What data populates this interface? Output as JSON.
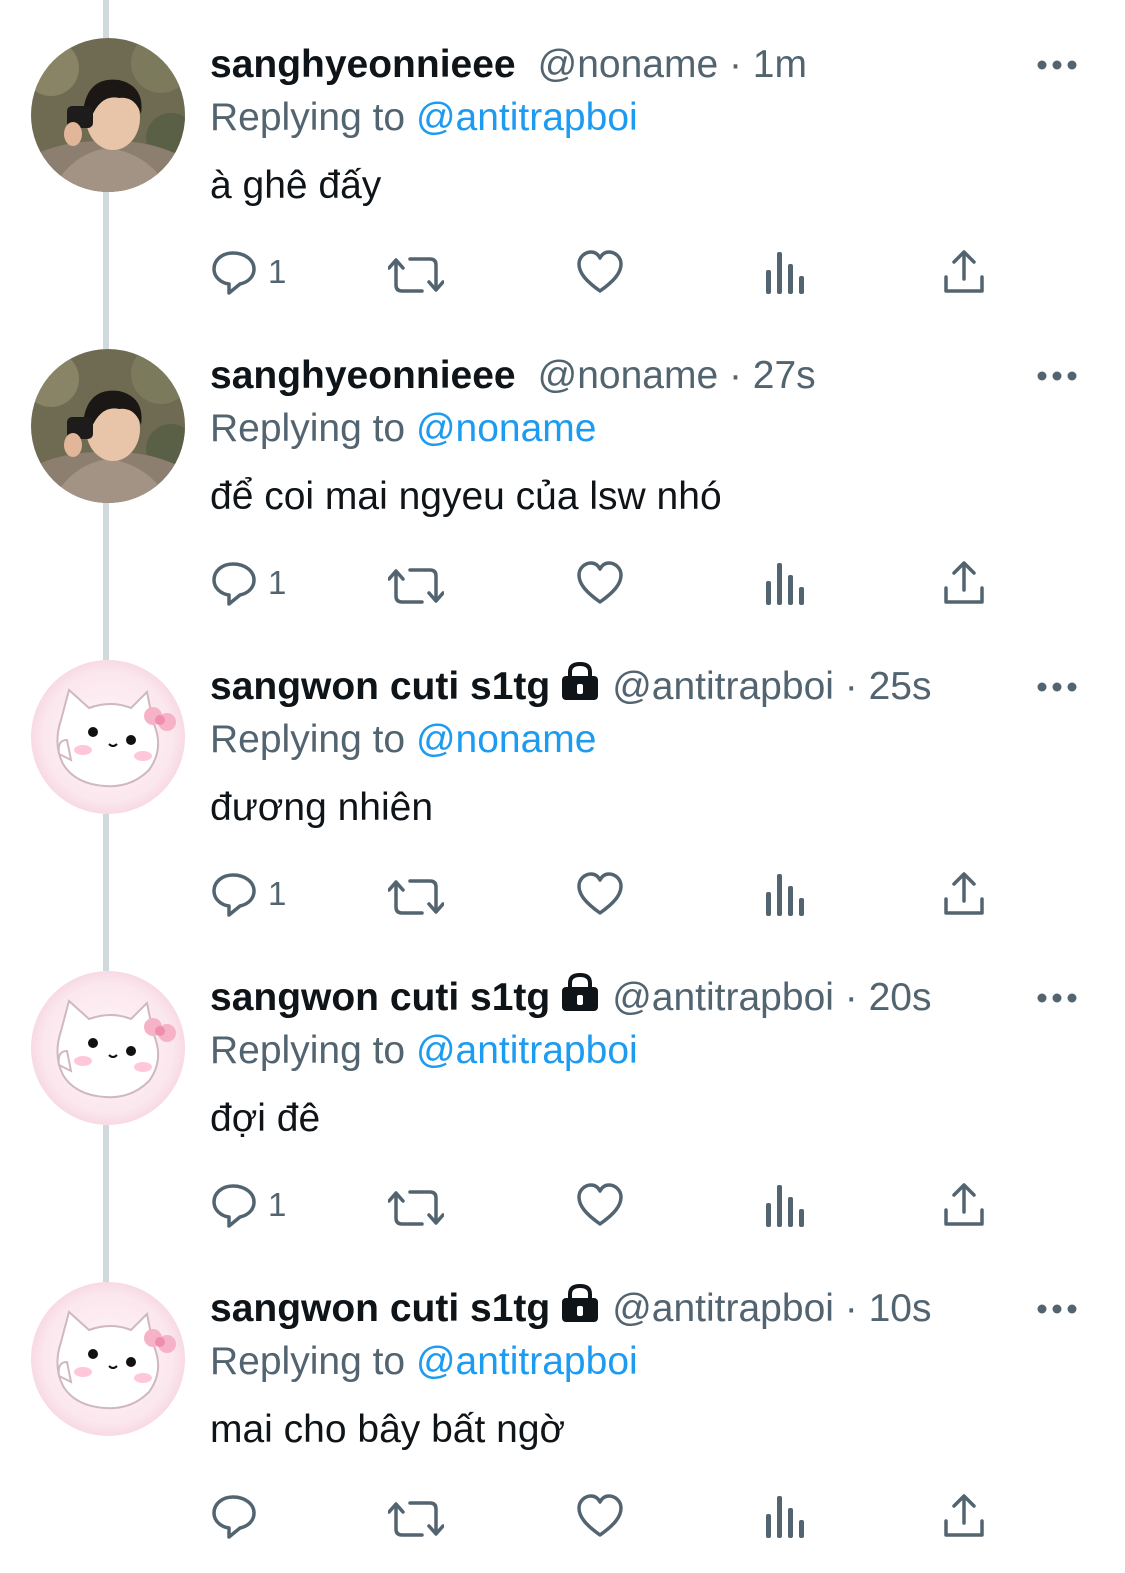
{
  "colors": {
    "accent": "#1d9bf0",
    "secondary_text": "#536471",
    "primary_text": "#0f1419",
    "thread_line": "#cfd9de"
  },
  "tweets": [
    {
      "display_name": "sanghyeonnieee",
      "protected": false,
      "handle": "@noname",
      "time": "· 1m",
      "reply_prefix": "Replying to ",
      "reply_to": "@antitrapboi",
      "text": "à ghê đấy",
      "reply_count": "1",
      "avatar": "photo-avatar"
    },
    {
      "display_name": "sanghyeonnieee",
      "protected": false,
      "handle": "@noname",
      "time": "· 27s",
      "reply_prefix": "Replying to ",
      "reply_to": "@noname",
      "text": "để coi mai ngyeu của lsw nhó",
      "reply_count": "1",
      "avatar": "photo-avatar"
    },
    {
      "display_name": "sangwon cuti s1tg",
      "protected": true,
      "handle": "@antitrapboi",
      "time": "· 25s",
      "reply_prefix": "Replying to ",
      "reply_to": "@noname",
      "text": "đương nhiên",
      "reply_count": "1",
      "avatar": "cat-avatar"
    },
    {
      "display_name": "sangwon cuti s1tg",
      "protected": true,
      "handle": "@antitrapboi",
      "time": "· 20s",
      "reply_prefix": "Replying to ",
      "reply_to": "@antitrapboi",
      "text": "đợi đê",
      "reply_count": "1",
      "avatar": "cat-avatar"
    },
    {
      "display_name": "sangwon cuti s1tg",
      "protected": true,
      "handle": "@antitrapboi",
      "time": "· 10s",
      "reply_prefix": "Replying to ",
      "reply_to": "@antitrapboi",
      "text": "mai cho bây bất ngờ",
      "reply_count": "",
      "avatar": "cat-avatar"
    }
  ],
  "icons": [
    "more-icon",
    "reply-icon",
    "retweet-icon",
    "like-icon",
    "views-icon",
    "share-icon",
    "lock-icon"
  ]
}
